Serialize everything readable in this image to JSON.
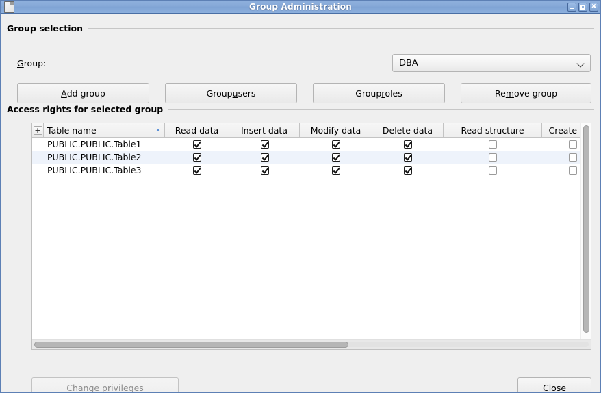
{
  "window": {
    "title": "Group Administration",
    "icon": "document-icon",
    "controls": [
      {
        "name": "minimize-button",
        "glyph": "minimize"
      },
      {
        "name": "maximize-button",
        "glyph": "maximize"
      },
      {
        "name": "close-button",
        "glyph": "✖"
      }
    ]
  },
  "group_selection": {
    "legend": "Group selection",
    "group_label_pre": "G",
    "group_label_post": "roup:",
    "combo": {
      "value": "DBA",
      "options": [
        "DBA"
      ]
    },
    "buttons": [
      {
        "name": "add-group-button",
        "pre": "",
        "mn": "A",
        "post": "dd group",
        "enabled": true
      },
      {
        "name": "group-users-button",
        "pre": "Group ",
        "mn": "u",
        "post": "sers",
        "enabled": true
      },
      {
        "name": "group-roles-button",
        "pre": "Group ",
        "mn": "r",
        "post": "oles",
        "enabled": true
      },
      {
        "name": "remove-group-button",
        "pre": "Re",
        "mn": "m",
        "post": "ove group",
        "enabled": true
      }
    ]
  },
  "access_rights": {
    "legend": "Access rights for selected group",
    "column_chooser_label": "+",
    "columns": [
      {
        "label": "Table name",
        "sorted": "asc"
      },
      {
        "label": "Read data"
      },
      {
        "label": "Insert data"
      },
      {
        "label": "Modify data"
      },
      {
        "label": "Delete data"
      },
      {
        "label": "Read structure"
      },
      {
        "label": "Create stru"
      }
    ],
    "rows": [
      {
        "name": "PUBLIC.PUBLIC.Table1",
        "read_data": true,
        "insert_data": true,
        "modify_data": true,
        "delete_data": true,
        "read_structure": false,
        "create_structure": false
      },
      {
        "name": "PUBLIC.PUBLIC.Table2",
        "read_data": true,
        "insert_data": true,
        "modify_data": true,
        "delete_data": true,
        "read_structure": false,
        "create_structure": false
      },
      {
        "name": "PUBLIC.PUBLIC.Table3",
        "read_data": true,
        "insert_data": true,
        "modify_data": true,
        "delete_data": true,
        "read_structure": false,
        "create_structure": false
      }
    ],
    "hscroll_thumb_percent": 57,
    "vscroll_thumb_percent": 97
  },
  "footer": {
    "change_privileges": {
      "pre": "",
      "mn": "C",
      "post": "hange privileges",
      "enabled": false
    },
    "close": {
      "label": "Close",
      "enabled": true
    }
  }
}
